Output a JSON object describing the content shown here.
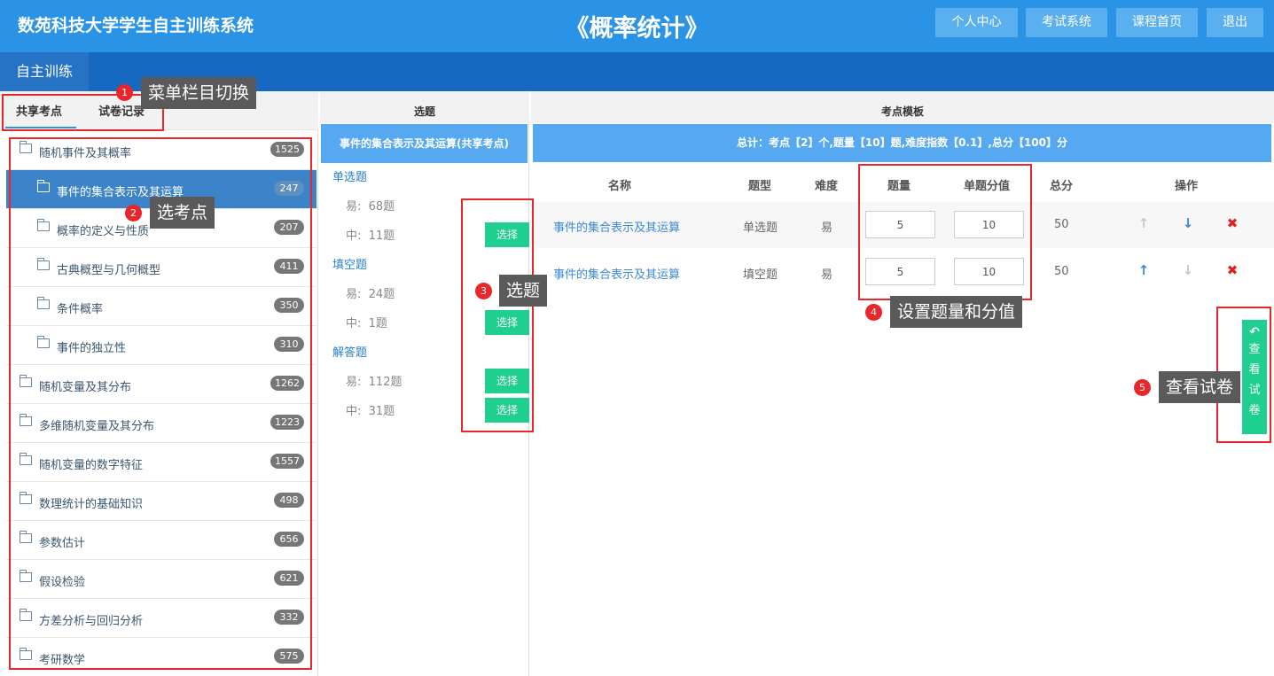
{
  "header": {
    "app_title": "数苑科技大学学生自主训练系统",
    "course_title": "《概率统计》",
    "nav": [
      "个人中心",
      "考试系统",
      "课程首页",
      "退出"
    ]
  },
  "subnav": {
    "tab": "自主训练"
  },
  "left": {
    "tabs": [
      "共享考点",
      "试卷记录"
    ],
    "tree": [
      {
        "label": "随机事件及其概率",
        "count": "1525",
        "expanded": true
      },
      {
        "label": "事件的集合表示及其运算",
        "count": "247",
        "selected": true
      },
      {
        "label": "概率的定义与性质",
        "count": "207"
      },
      {
        "label": "古典概型与几何概型",
        "count": "411"
      },
      {
        "label": "条件概率",
        "count": "350"
      },
      {
        "label": "事件的独立性",
        "count": "310"
      },
      {
        "label": "随机变量及其分布",
        "count": "1262"
      },
      {
        "label": "多维随机变量及其分布",
        "count": "1223"
      },
      {
        "label": "随机变量的数字特征",
        "count": "1557"
      },
      {
        "label": "数理统计的基础知识",
        "count": "498"
      },
      {
        "label": "参数估计",
        "count": "656"
      },
      {
        "label": "假设检验",
        "count": "621"
      },
      {
        "label": "方差分析与回归分析",
        "count": "332"
      },
      {
        "label": "考研数学",
        "count": "575"
      }
    ]
  },
  "middle": {
    "header": "选题",
    "topic": "事件的集合表示及其运算(共享考点)",
    "groups": [
      {
        "type": "单选题",
        "levels": [
          {
            "label": "易:",
            "count": "68题"
          },
          {
            "label": "中:",
            "count": "11题"
          }
        ]
      },
      {
        "type": "填空题",
        "levels": [
          {
            "label": "易:",
            "count": "24题"
          },
          {
            "label": "中:",
            "count": "1题"
          }
        ]
      },
      {
        "type": "解答题",
        "levels": [
          {
            "label": "易:",
            "count": "112题"
          },
          {
            "label": "中:",
            "count": "31题"
          }
        ]
      }
    ],
    "select_label": "选择"
  },
  "right": {
    "header": "考点模板",
    "summary": "总计：考点【2】个,题量【10】题,难度指数【0.1】,总分【100】分",
    "columns": [
      "名称",
      "题型",
      "难度",
      "题量",
      "单题分值",
      "总分",
      "操作"
    ],
    "rows": [
      {
        "name": "事件的集合表示及其运算",
        "type": "单选题",
        "difficulty": "易",
        "quantity": "5",
        "score": "10",
        "total": "50"
      },
      {
        "name": "事件的集合表示及其运算",
        "type": "填空题",
        "difficulty": "易",
        "quantity": "5",
        "score": "10",
        "total": "50"
      }
    ],
    "view_paper_chars": [
      "查",
      "看",
      "试",
      "卷"
    ]
  },
  "annotations": [
    {
      "num": "1",
      "text": "菜单栏目切换"
    },
    {
      "num": "2",
      "text": "选考点"
    },
    {
      "num": "3",
      "text": "选题"
    },
    {
      "num": "4",
      "text": "设置题量和分值"
    },
    {
      "num": "5",
      "text": "查看试卷"
    }
  ],
  "colors": {
    "header": "#2a93e6",
    "subbar": "#1668c0",
    "accent_green": "#1fcf8f",
    "annotation_red": "#e8262b"
  }
}
